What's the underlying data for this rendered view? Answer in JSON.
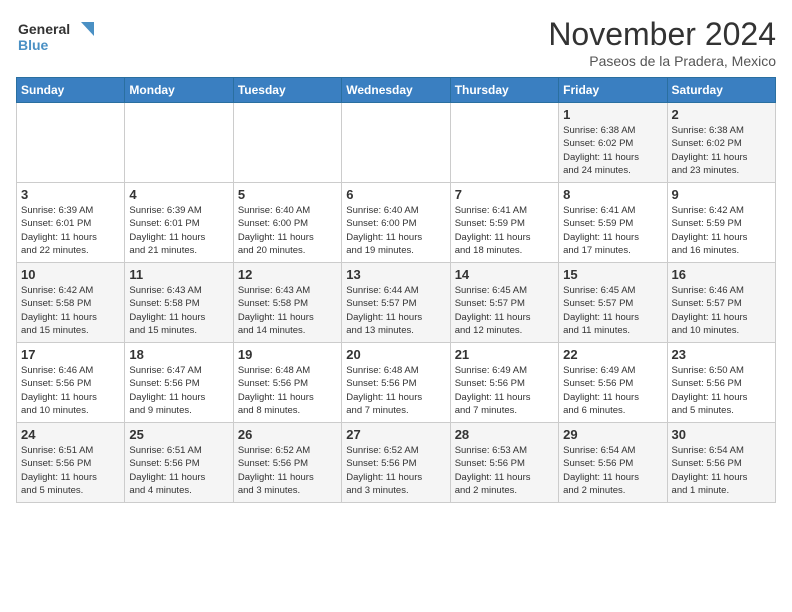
{
  "logo": {
    "line1": "General",
    "line2": "Blue"
  },
  "title": "November 2024",
  "location": "Paseos de la Pradera, Mexico",
  "days_of_week": [
    "Sunday",
    "Monday",
    "Tuesday",
    "Wednesday",
    "Thursday",
    "Friday",
    "Saturday"
  ],
  "weeks": [
    [
      {
        "day": "",
        "info": ""
      },
      {
        "day": "",
        "info": ""
      },
      {
        "day": "",
        "info": ""
      },
      {
        "day": "",
        "info": ""
      },
      {
        "day": "",
        "info": ""
      },
      {
        "day": "1",
        "info": "Sunrise: 6:38 AM\nSunset: 6:02 PM\nDaylight: 11 hours\nand 24 minutes."
      },
      {
        "day": "2",
        "info": "Sunrise: 6:38 AM\nSunset: 6:02 PM\nDaylight: 11 hours\nand 23 minutes."
      }
    ],
    [
      {
        "day": "3",
        "info": "Sunrise: 6:39 AM\nSunset: 6:01 PM\nDaylight: 11 hours\nand 22 minutes."
      },
      {
        "day": "4",
        "info": "Sunrise: 6:39 AM\nSunset: 6:01 PM\nDaylight: 11 hours\nand 21 minutes."
      },
      {
        "day": "5",
        "info": "Sunrise: 6:40 AM\nSunset: 6:00 PM\nDaylight: 11 hours\nand 20 minutes."
      },
      {
        "day": "6",
        "info": "Sunrise: 6:40 AM\nSunset: 6:00 PM\nDaylight: 11 hours\nand 19 minutes."
      },
      {
        "day": "7",
        "info": "Sunrise: 6:41 AM\nSunset: 5:59 PM\nDaylight: 11 hours\nand 18 minutes."
      },
      {
        "day": "8",
        "info": "Sunrise: 6:41 AM\nSunset: 5:59 PM\nDaylight: 11 hours\nand 17 minutes."
      },
      {
        "day": "9",
        "info": "Sunrise: 6:42 AM\nSunset: 5:59 PM\nDaylight: 11 hours\nand 16 minutes."
      }
    ],
    [
      {
        "day": "10",
        "info": "Sunrise: 6:42 AM\nSunset: 5:58 PM\nDaylight: 11 hours\nand 15 minutes."
      },
      {
        "day": "11",
        "info": "Sunrise: 6:43 AM\nSunset: 5:58 PM\nDaylight: 11 hours\nand 15 minutes."
      },
      {
        "day": "12",
        "info": "Sunrise: 6:43 AM\nSunset: 5:58 PM\nDaylight: 11 hours\nand 14 minutes."
      },
      {
        "day": "13",
        "info": "Sunrise: 6:44 AM\nSunset: 5:57 PM\nDaylight: 11 hours\nand 13 minutes."
      },
      {
        "day": "14",
        "info": "Sunrise: 6:45 AM\nSunset: 5:57 PM\nDaylight: 11 hours\nand 12 minutes."
      },
      {
        "day": "15",
        "info": "Sunrise: 6:45 AM\nSunset: 5:57 PM\nDaylight: 11 hours\nand 11 minutes."
      },
      {
        "day": "16",
        "info": "Sunrise: 6:46 AM\nSunset: 5:57 PM\nDaylight: 11 hours\nand 10 minutes."
      }
    ],
    [
      {
        "day": "17",
        "info": "Sunrise: 6:46 AM\nSunset: 5:56 PM\nDaylight: 11 hours\nand 10 minutes."
      },
      {
        "day": "18",
        "info": "Sunrise: 6:47 AM\nSunset: 5:56 PM\nDaylight: 11 hours\nand 9 minutes."
      },
      {
        "day": "19",
        "info": "Sunrise: 6:48 AM\nSunset: 5:56 PM\nDaylight: 11 hours\nand 8 minutes."
      },
      {
        "day": "20",
        "info": "Sunrise: 6:48 AM\nSunset: 5:56 PM\nDaylight: 11 hours\nand 7 minutes."
      },
      {
        "day": "21",
        "info": "Sunrise: 6:49 AM\nSunset: 5:56 PM\nDaylight: 11 hours\nand 7 minutes."
      },
      {
        "day": "22",
        "info": "Sunrise: 6:49 AM\nSunset: 5:56 PM\nDaylight: 11 hours\nand 6 minutes."
      },
      {
        "day": "23",
        "info": "Sunrise: 6:50 AM\nSunset: 5:56 PM\nDaylight: 11 hours\nand 5 minutes."
      }
    ],
    [
      {
        "day": "24",
        "info": "Sunrise: 6:51 AM\nSunset: 5:56 PM\nDaylight: 11 hours\nand 5 minutes."
      },
      {
        "day": "25",
        "info": "Sunrise: 6:51 AM\nSunset: 5:56 PM\nDaylight: 11 hours\nand 4 minutes."
      },
      {
        "day": "26",
        "info": "Sunrise: 6:52 AM\nSunset: 5:56 PM\nDaylight: 11 hours\nand 3 minutes."
      },
      {
        "day": "27",
        "info": "Sunrise: 6:52 AM\nSunset: 5:56 PM\nDaylight: 11 hours\nand 3 minutes."
      },
      {
        "day": "28",
        "info": "Sunrise: 6:53 AM\nSunset: 5:56 PM\nDaylight: 11 hours\nand 2 minutes."
      },
      {
        "day": "29",
        "info": "Sunrise: 6:54 AM\nSunset: 5:56 PM\nDaylight: 11 hours\nand 2 minutes."
      },
      {
        "day": "30",
        "info": "Sunrise: 6:54 AM\nSunset: 5:56 PM\nDaylight: 11 hours\nand 1 minute."
      }
    ]
  ]
}
